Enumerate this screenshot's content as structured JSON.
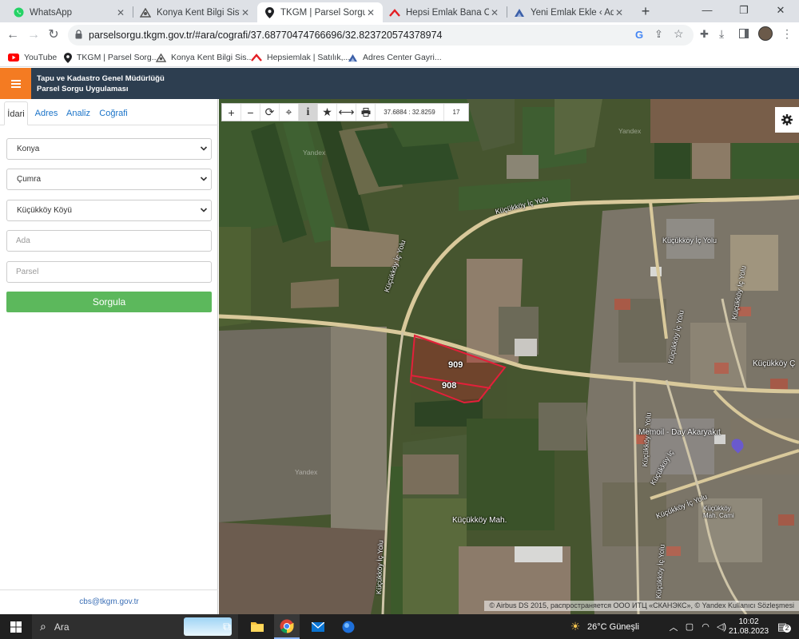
{
  "browser": {
    "tabs": [
      {
        "label": "WhatsApp",
        "icon": "whatsapp-icon",
        "active": false
      },
      {
        "label": "Konya Kent Bilgi Sistemi",
        "icon": "konya-logo-icon",
        "active": false
      },
      {
        "label": "TKGM | Parsel Sorgu Uyg",
        "icon": "map-pin-icon",
        "active": true
      },
      {
        "label": "Hepsi Emlak Bana Özel",
        "icon": "hepsiemlak-icon",
        "active": false
      },
      {
        "label": "Yeni Emlak Ekle ‹ Adres Ce",
        "icon": "adres-center-icon",
        "active": false
      }
    ],
    "url": "parselsorgu.tkgm.gov.tr/#ara/cografi/37.68770474766696/32.823720574378974",
    "bookmarks": [
      {
        "label": "YouTube",
        "icon": "youtube-icon"
      },
      {
        "label": "TKGM | Parsel Sorg...",
        "icon": "map-pin-icon"
      },
      {
        "label": "Konya Kent Bilgi Sis...",
        "icon": "konya-logo-icon"
      },
      {
        "label": "Hepsiemlak | Satılık,...",
        "icon": "hepsiemlak-icon"
      },
      {
        "label": "Adres Center Gayri...",
        "icon": "adres-center-icon"
      }
    ]
  },
  "app": {
    "title_line1": "Tapu ve Kadastro Genel Müdürlüğü",
    "title_line2": "Parsel Sorgu Uygulaması"
  },
  "sidebar": {
    "tabs": [
      "İdari",
      "Adres",
      "Analiz",
      "Coğrafi"
    ],
    "active_tab": "İdari",
    "il": "Konya",
    "ilce": "Çumra",
    "mahalle": "Küçükköy Köyü",
    "ada_placeholder": "Ada",
    "parsel_placeholder": "Parsel",
    "submit_label": "Sorgula",
    "footer_email": "cbs@tkgm.gov.tr"
  },
  "map": {
    "coordinates": "37.6884 : 32.8259",
    "zoom_level": "17",
    "parcels": [
      "909",
      "908"
    ],
    "labels": {
      "road_top": "Küçükköy İç Yolu",
      "road_right_top": "Küçükköy İç Yolu",
      "road_vertical_left": "Küçükköy İç Yolu",
      "road_vertical_mid": "Küçükköy İç Yolu",
      "road_vertical_right": "Küçükköy İç Yolu",
      "road_lower_left": "Küçükköy İç Yolu",
      "road_lower_mid": "Küçükköy İç Yolu",
      "road_lower_right": "Küçükköy İç Yolu",
      "road_diag": "Küçükköy İç Yolu",
      "road_junction": "Küçükköy İç",
      "village_name": "Küçükköy Ç",
      "fuel_station": "Memoil - Day Akaryakıt",
      "neighbourhood": "Küçükköy Mah.",
      "mosque": "Küçükköy Mah. Cami"
    },
    "watermark": "Yandex",
    "copyright": "© Airbus DS 2015, распространяется ООО ИТЦ «СКАНЭКС»,  © Yandex  Kullanıcı Sözleşmesi"
  },
  "taskbar": {
    "search_placeholder": "Ara",
    "weather": "26°C  Güneşli",
    "time": "10:02",
    "date": "21.08.2023",
    "notification_count": "2"
  }
}
